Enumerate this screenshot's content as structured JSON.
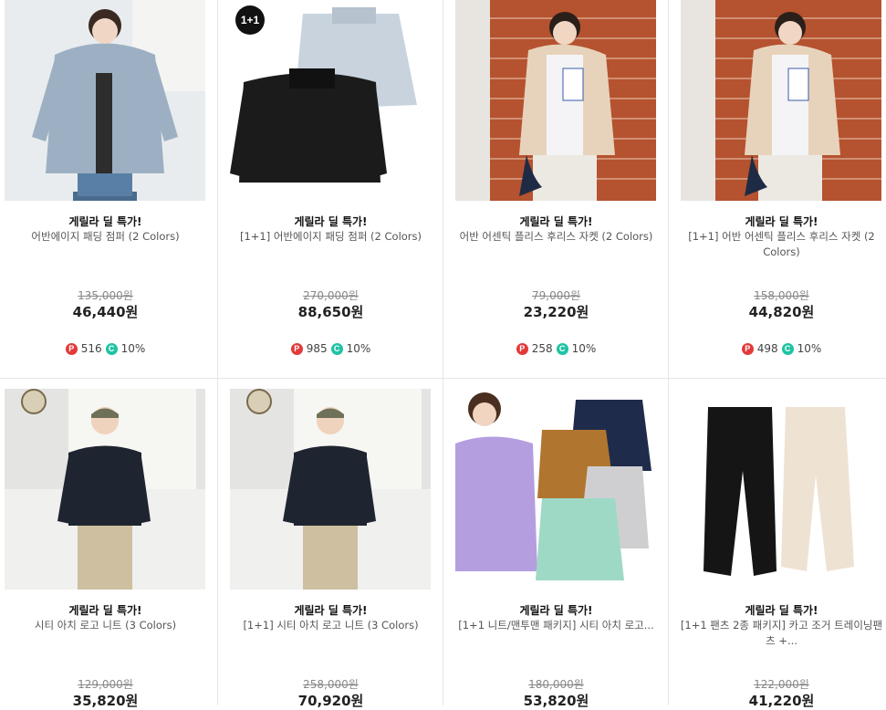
{
  "products": [
    {
      "deal": "게릴라 딜 특가!",
      "name": "어반에이지 패딩 점퍼 (2 Colors)",
      "original_price": "135,000원",
      "price": "46,440원",
      "points": "516",
      "coupon": "10%",
      "badge": ""
    },
    {
      "deal": "게릴라 딜 특가!",
      "name": "[1+1] 어반에이지 패딩 점퍼 (2 Colors)",
      "original_price": "270,000원",
      "price": "88,650원",
      "points": "985",
      "coupon": "10%",
      "badge": "1+1"
    },
    {
      "deal": "게릴라 딜 특가!",
      "name": "어반 어센틱 플리스 후리스 자켓 (2 Colors)",
      "original_price": "79,000원",
      "price": "23,220원",
      "points": "258",
      "coupon": "10%",
      "badge": ""
    },
    {
      "deal": "게릴라 딜 특가!",
      "name": "[1+1] 어반 어센틱 플리스 후리스 자켓 (2 Colors)",
      "original_price": "158,000원",
      "price": "44,820원",
      "points": "498",
      "coupon": "10%",
      "badge": ""
    },
    {
      "deal": "게릴라 딜 특가!",
      "name": "시티 아치 로고 니트 (3 Colors)",
      "original_price": "129,000원",
      "price": "35,820원",
      "badge": ""
    },
    {
      "deal": "게릴라 딜 특가!",
      "name": "[1+1] 시티 아치 로고 니트 (3 Colors)",
      "original_price": "258,000원",
      "price": "70,920원",
      "badge": ""
    },
    {
      "deal": "게릴라 딜 특가!",
      "name": "[1+1 니트/맨투맨 패키지] 시티 아치 로고...",
      "original_price": "180,000원",
      "price": "53,820원",
      "badge": ""
    },
    {
      "deal": "게릴라 딜 특가!",
      "name": "[1+1 팬츠 2종 패키지] 카고 조거 트레이닝팬츠 +...",
      "original_price": "122,000원",
      "price": "41,220원",
      "badge": ""
    }
  ],
  "icons": {
    "point": "P",
    "coupon": "C"
  },
  "colors": {
    "point_icon": "#e23a3a",
    "coupon_icon": "#1fc3a4",
    "divider": "#e6e6e6"
  }
}
